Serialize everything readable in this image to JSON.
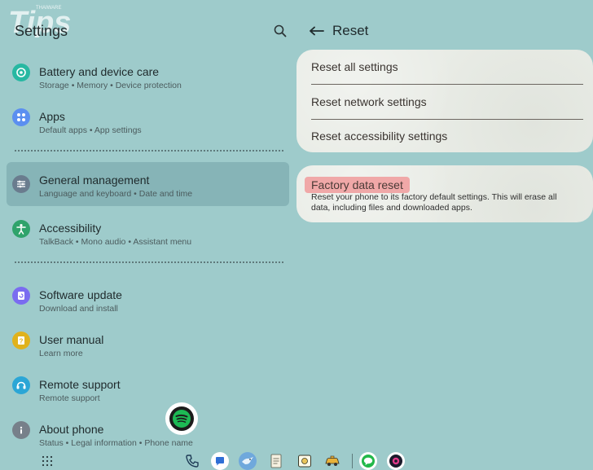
{
  "watermark": {
    "brand": "Tips",
    "small": "THAIWARE"
  },
  "left_pane": {
    "title": "Settings",
    "items": [
      {
        "title": "Battery and device care",
        "subtitle": "Storage  •  Memory  •  Device protection",
        "icon": "battery-care-icon",
        "color": "#27b8a2"
      },
      {
        "title": "Apps",
        "subtitle": "Default apps  •  App settings",
        "icon": "apps-icon",
        "color": "#5b8ff0"
      },
      {
        "title": "General management",
        "subtitle": "Language and keyboard  •  Date and time",
        "icon": "sliders-icon",
        "color": "#6a7c8e"
      },
      {
        "title": "Accessibility",
        "subtitle": "TalkBack  •  Mono audio  •  Assistant menu",
        "icon": "accessibility-icon",
        "color": "#2fa36b"
      },
      {
        "title": "Software update",
        "subtitle": "Download and install",
        "icon": "software-update-icon",
        "color": "#7a6cf0"
      },
      {
        "title": "User manual",
        "subtitle": "Learn more",
        "icon": "manual-icon",
        "color": "#e0b21c"
      },
      {
        "title": "Remote support",
        "subtitle": "Remote support",
        "icon": "headset-icon",
        "color": "#2ba6d6"
      },
      {
        "title": "About phone",
        "subtitle": "Status  •  Legal information  •  Phone name",
        "icon": "info-icon",
        "color": "#77808a"
      }
    ]
  },
  "right_pane": {
    "title": "Reset",
    "options": [
      {
        "label": "Reset all settings"
      },
      {
        "label": "Reset network settings"
      },
      {
        "label": "Reset accessibility settings"
      }
    ],
    "factory_reset": {
      "title": "Factory data reset",
      "description": "Reset your phone to its factory default settings. This will erase all data, including files and downloaded apps."
    }
  },
  "floating_app": {
    "icon": "spotify-icon",
    "color": "#1db954"
  },
  "dock": {
    "apps": [
      {
        "icon": "phone-icon"
      },
      {
        "icon": "messages-icon"
      },
      {
        "icon": "bird-app-icon"
      },
      {
        "icon": "notes-icon"
      },
      {
        "icon": "gallery-icon"
      },
      {
        "icon": "taxi-app-icon"
      },
      {
        "icon": "line-icon"
      },
      {
        "icon": "camera-app-icon"
      }
    ]
  }
}
